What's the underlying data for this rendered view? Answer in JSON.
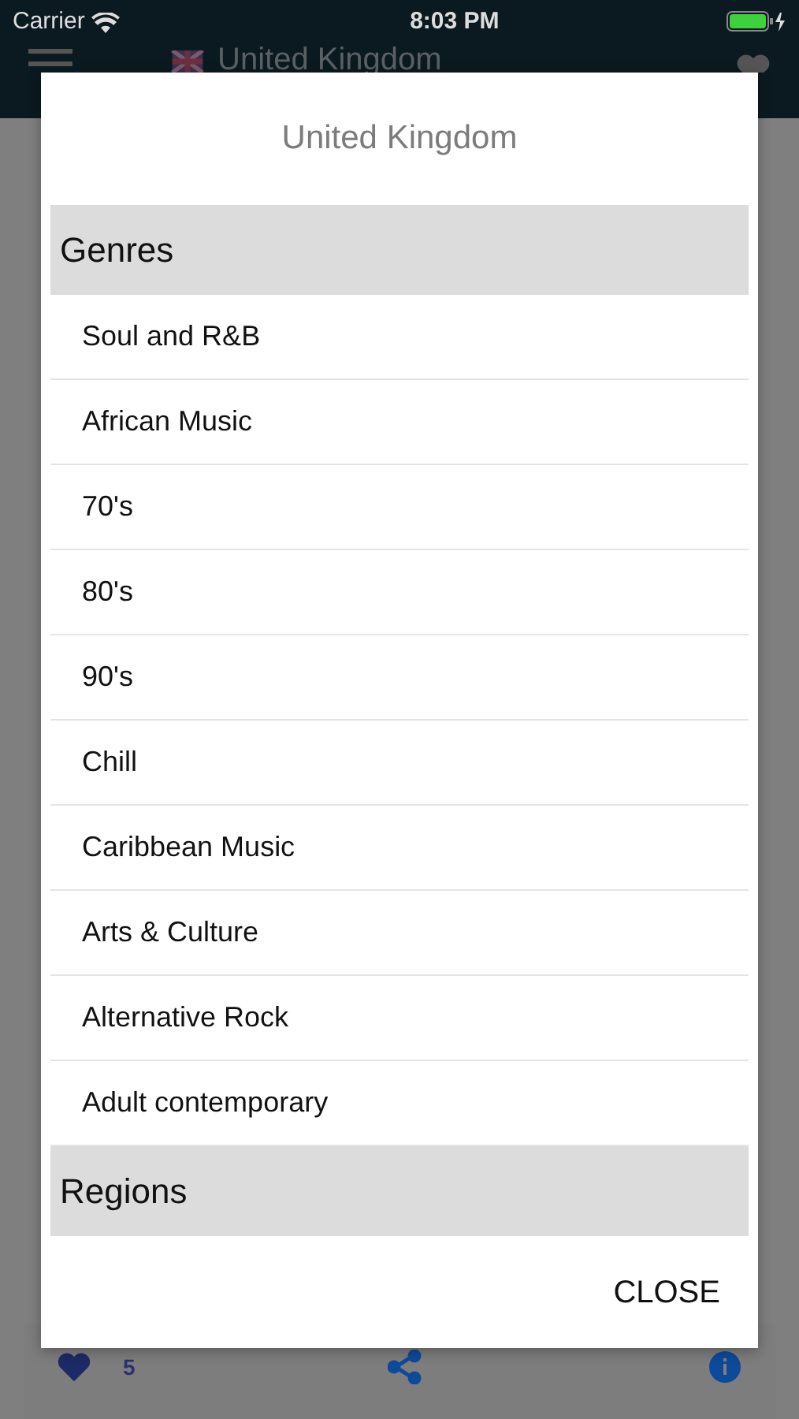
{
  "status_bar": {
    "carrier": "Carrier",
    "time": "8:03 PM"
  },
  "app_bar": {
    "title": "United Kingdom"
  },
  "card_footer": {
    "like_count": "5"
  },
  "dialog": {
    "title": "United Kingdom",
    "sections": [
      {
        "heading": "Genres",
        "items": [
          "Soul and R&B",
          "African Music",
          "70's",
          "80's",
          "90's",
          "Chill",
          "Caribbean Music",
          "Arts & Culture",
          "Alternative Rock",
          "Adult contemporary"
        ]
      },
      {
        "heading": "Regions"
      }
    ],
    "close_button": "CLOSE"
  }
}
